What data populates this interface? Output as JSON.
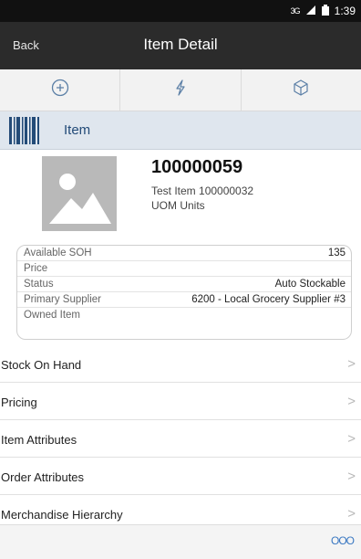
{
  "status_bar": {
    "network": "3G",
    "time": "1:39"
  },
  "header": {
    "back_label": "Back",
    "title": "Item Detail"
  },
  "toolbar": {
    "icons": [
      "add-icon",
      "flash-icon",
      "cube-icon"
    ]
  },
  "section": {
    "label": "Item"
  },
  "item": {
    "number": "100000059",
    "description": "Test Item 100000032",
    "uom": "UOM Units"
  },
  "details": [
    {
      "label": "Available SOH",
      "value": "135"
    },
    {
      "label": "Price",
      "value": ""
    },
    {
      "label": "Status",
      "value": "Auto Stockable"
    },
    {
      "label": "Primary Supplier",
      "value": "6200 - Local Grocery Supplier #3"
    },
    {
      "label": "Owned Item",
      "value": ""
    }
  ],
  "menu": [
    {
      "label": "Stock On Hand"
    },
    {
      "label": "Pricing"
    },
    {
      "label": "Item Attributes"
    },
    {
      "label": "Order Attributes"
    },
    {
      "label": "Merchandise Hierarchy"
    }
  ],
  "footer": {
    "more_label": "OOO"
  },
  "colors": {
    "header": "#2b2b2b",
    "section_bg": "#dfe6ee",
    "accent": "#234b78",
    "link": "#3a78c2"
  }
}
